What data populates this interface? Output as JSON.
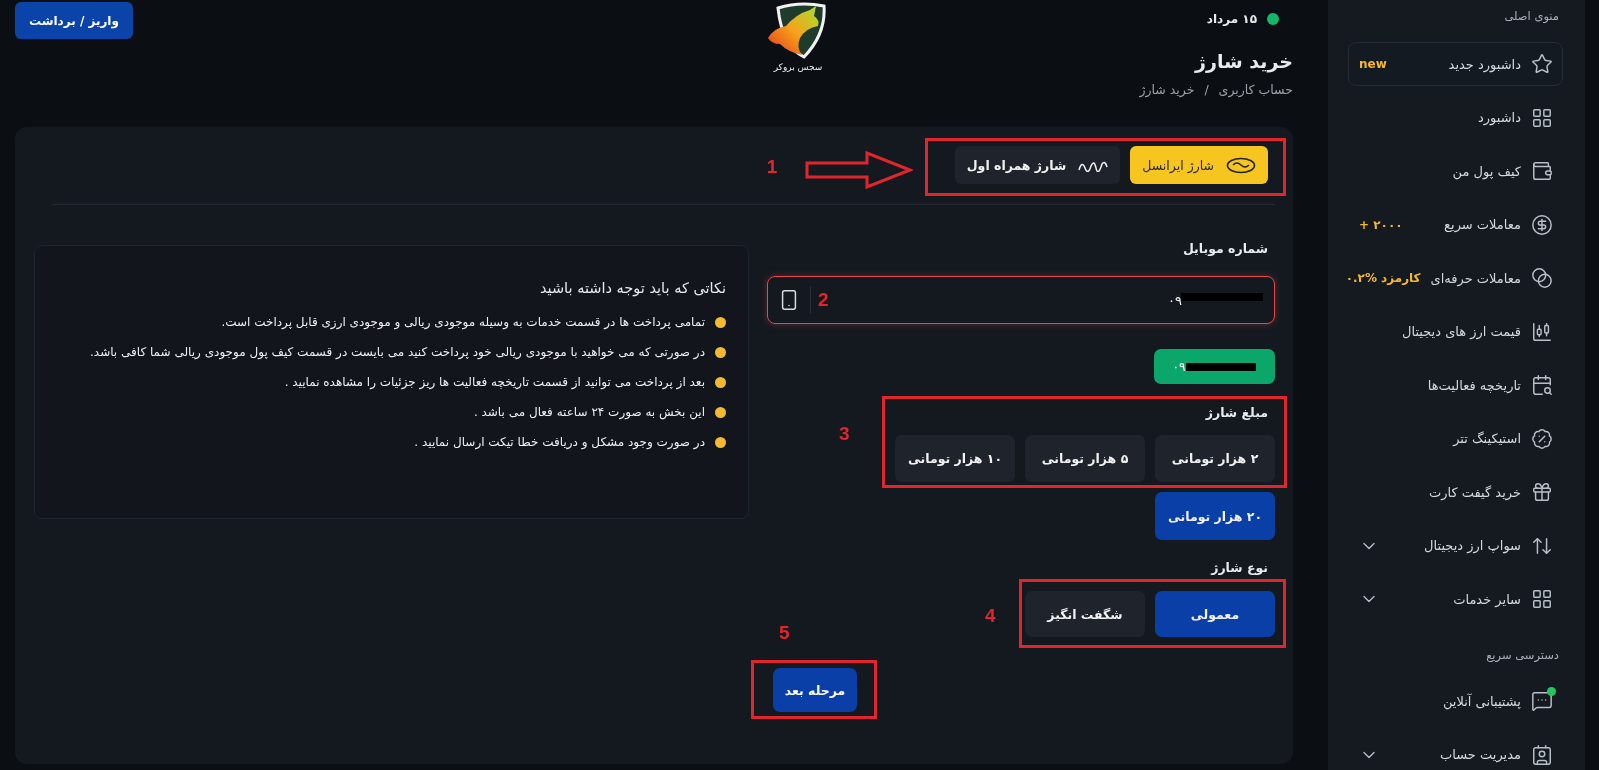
{
  "header": {
    "action_button": "واریز / برداشت",
    "logo_text": "سجس بروکر",
    "date": "۱۵ مرداد",
    "online": true,
    "title": "خرید شارژ",
    "breadcrumb": [
      "حساب کاربری",
      "خرید شارژ"
    ],
    "separator": "/"
  },
  "operator_tabs": {
    "annotation": "1",
    "tabs": [
      {
        "label": "شارژ ایرانسل",
        "selected": true
      },
      {
        "label": "شارژ همراه اول",
        "selected": false
      }
    ]
  },
  "mobile": {
    "label": "شماره موبایل",
    "value": "۰۹",
    "redacted": true,
    "annotation": "2"
  },
  "saved_number": {
    "label": "۰۹",
    "redacted": true
  },
  "amount": {
    "label": "مبلغ شارژ",
    "annotation": "3",
    "options": [
      {
        "label": "۲ هزار تومانی",
        "selected": false
      },
      {
        "label": "۵ هزار تومانی",
        "selected": false
      },
      {
        "label": "۱۰ هزار تومانی",
        "selected": false
      },
      {
        "label": "۲۰ هزار تومانی",
        "selected": true
      }
    ]
  },
  "charge_type": {
    "label": "نوع شارژ",
    "annotation": "4",
    "options": [
      {
        "label": "معمولی",
        "selected": true
      },
      {
        "label": "شگفت انگیز",
        "selected": false
      }
    ]
  },
  "next_button": {
    "label": "مرحله بعد",
    "annotation": "5"
  },
  "notes": {
    "title": "نکاتی که باید توجه داشته باشید",
    "items": [
      "تمامی پرداخت ها در قسمت خدمات به وسیله موجودی ریالی و موجودی ارزی قابل پرداخت است.",
      "در صورتی که می خواهید با موجودی ریالی خود پرداخت کنید می بایست در قسمت کیف پول موجودی ریالی شما کافی باشد.",
      "بعد از پرداخت می توانید از قسمت تاریخچه فعالیت ها ریز جزئیات را مشاهده نمایید .",
      "این بخش به صورت ۲۴ ساعته فعال می باشد .",
      "در صورت وجود مشکل و دریافت خطا تیکت ارسال نمایید ."
    ]
  },
  "sidebar": {
    "sections": [
      {
        "title": "منوی اصلی",
        "items": [
          {
            "label": "داشبورد جدید",
            "selected": true,
            "badge": "new"
          },
          {
            "label": "داشبورد",
            "selected": false
          },
          {
            "label": "کیف پول من",
            "selected": false
          },
          {
            "label": "معاملات سریع",
            "selected": false,
            "badge": "۲۰۰۰ +"
          },
          {
            "label": "معاملات حرفه‌ای",
            "selected": false,
            "badge": "کارمزد %۰.۲"
          },
          {
            "label": "قیمت ارز های دیجیتال",
            "selected": false
          },
          {
            "label": "تاریخچه فعالیت‌ها",
            "selected": false
          },
          {
            "label": "استیکینگ تتر",
            "selected": false
          },
          {
            "label": "خرید گیفت کارت",
            "selected": false
          },
          {
            "label": "سواپ ارز دیجیتال",
            "selected": false,
            "expanded": false
          },
          {
            "label": "سایر خدمات",
            "selected": false,
            "expanded": false
          }
        ]
      },
      {
        "title": "دسترسی سریع",
        "items": [
          {
            "label": "پشتیبانی آنلاین",
            "selected": false,
            "online": true
          },
          {
            "label": "مدیریت حساب",
            "selected": false,
            "expanded": false
          }
        ]
      }
    ]
  }
}
